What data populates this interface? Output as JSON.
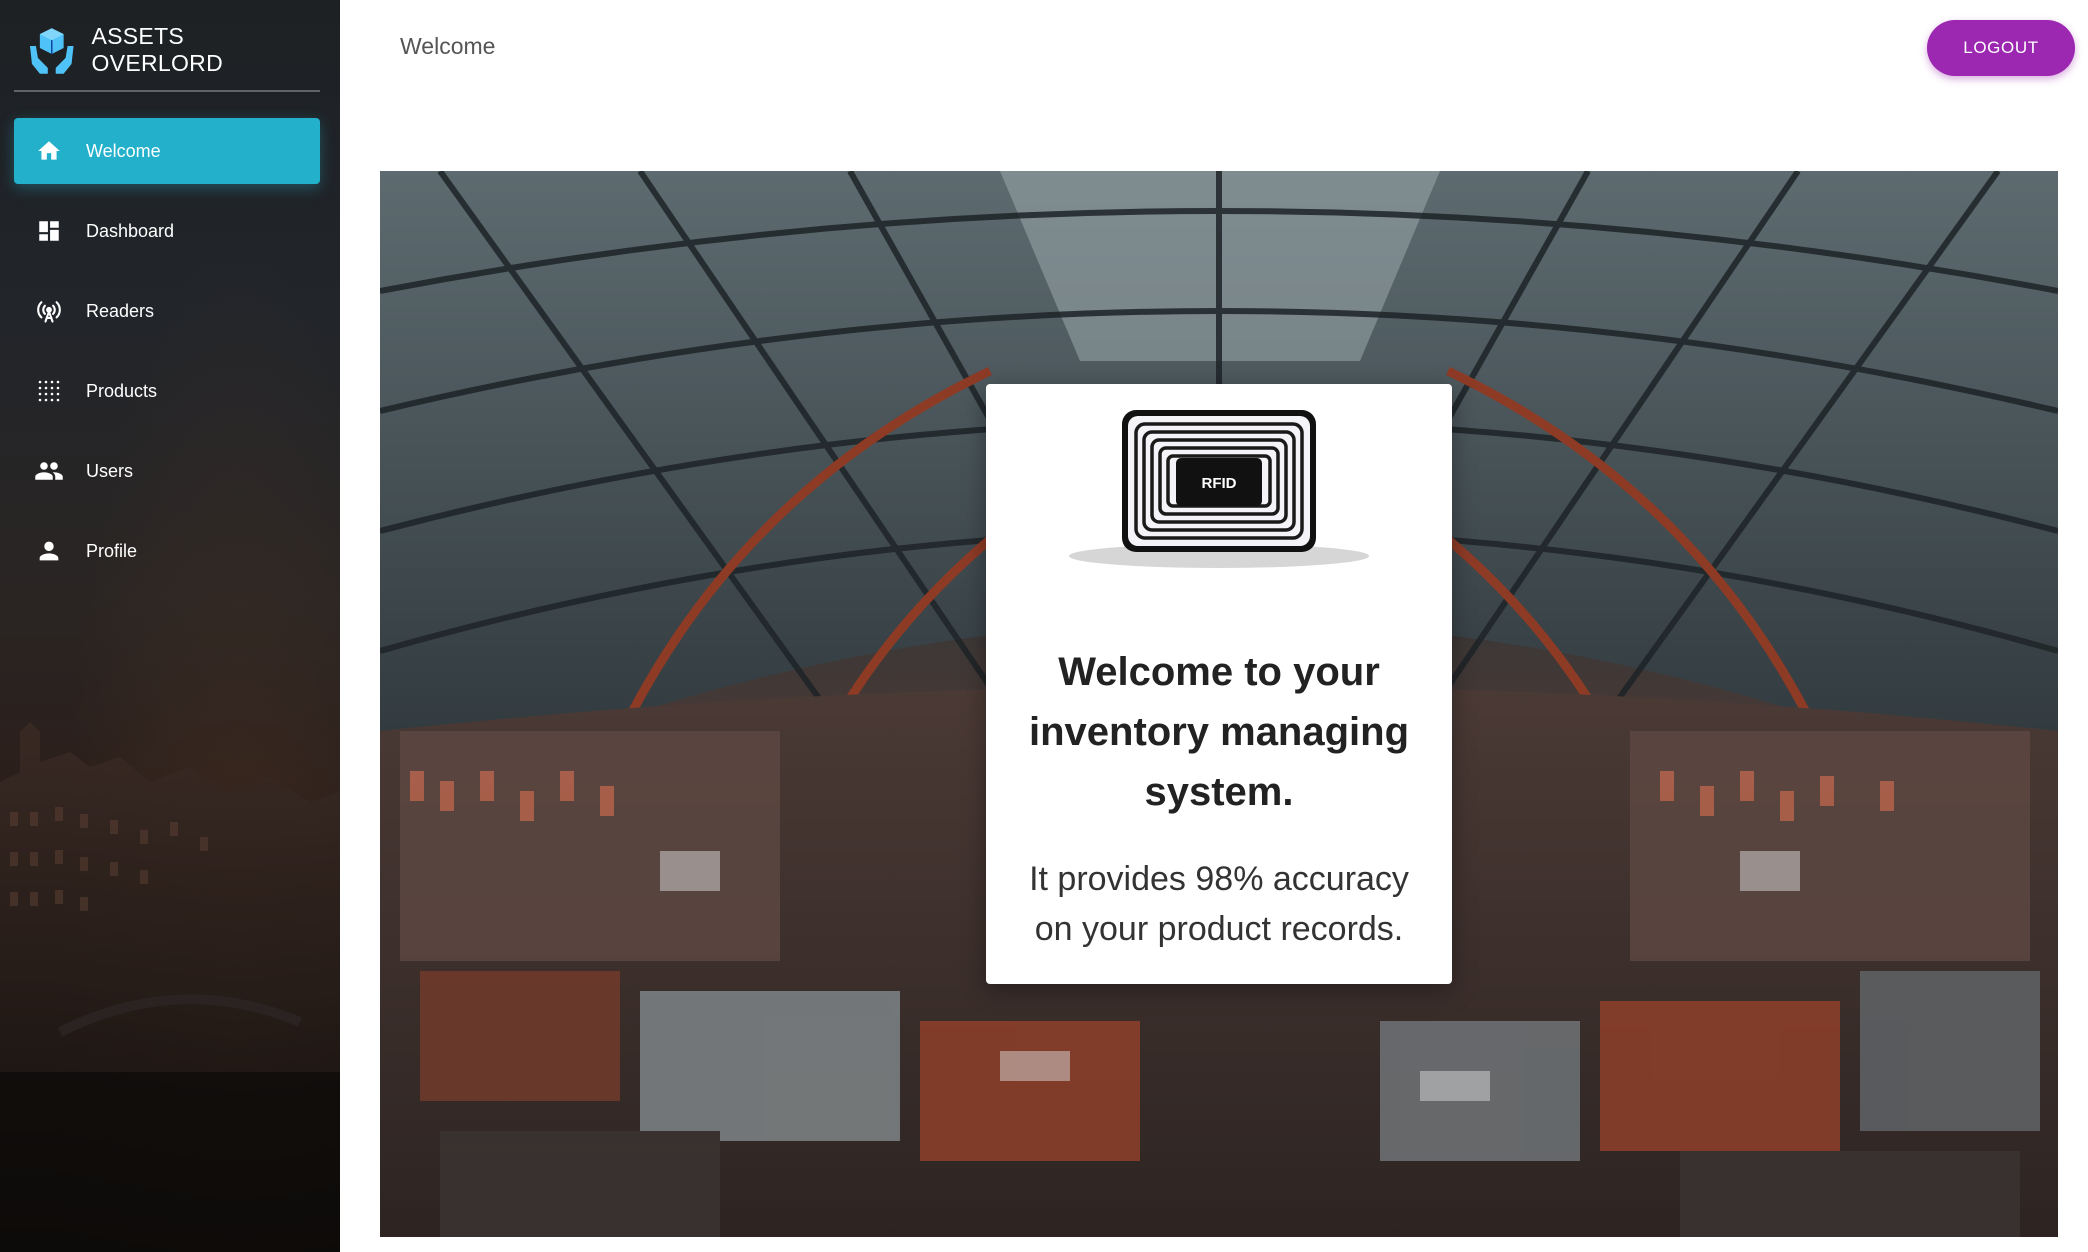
{
  "app": {
    "name": "ASSETS OVERLORD"
  },
  "sidebar": {
    "items": [
      {
        "label": "Welcome",
        "icon": "home-icon",
        "active": true
      },
      {
        "label": "Dashboard",
        "icon": "dashboard-icon",
        "active": false
      },
      {
        "label": "Readers",
        "icon": "antenna-icon",
        "active": false
      },
      {
        "label": "Products",
        "icon": "grid-dots-icon",
        "active": false
      },
      {
        "label": "Users",
        "icon": "people-icon",
        "active": false
      },
      {
        "label": "Profile",
        "icon": "person-icon",
        "active": false
      }
    ]
  },
  "header": {
    "title": "Welcome",
    "logout_label": "LOGOUT"
  },
  "card": {
    "image_label": "RFID",
    "heading": "Welcome to your inventory managing system.",
    "text": "It provides 98% accuracy on your product records."
  },
  "colors": {
    "accent": "#22b0cb",
    "logout": "#9c27b0",
    "brand_icon": "#4fc3f7"
  }
}
